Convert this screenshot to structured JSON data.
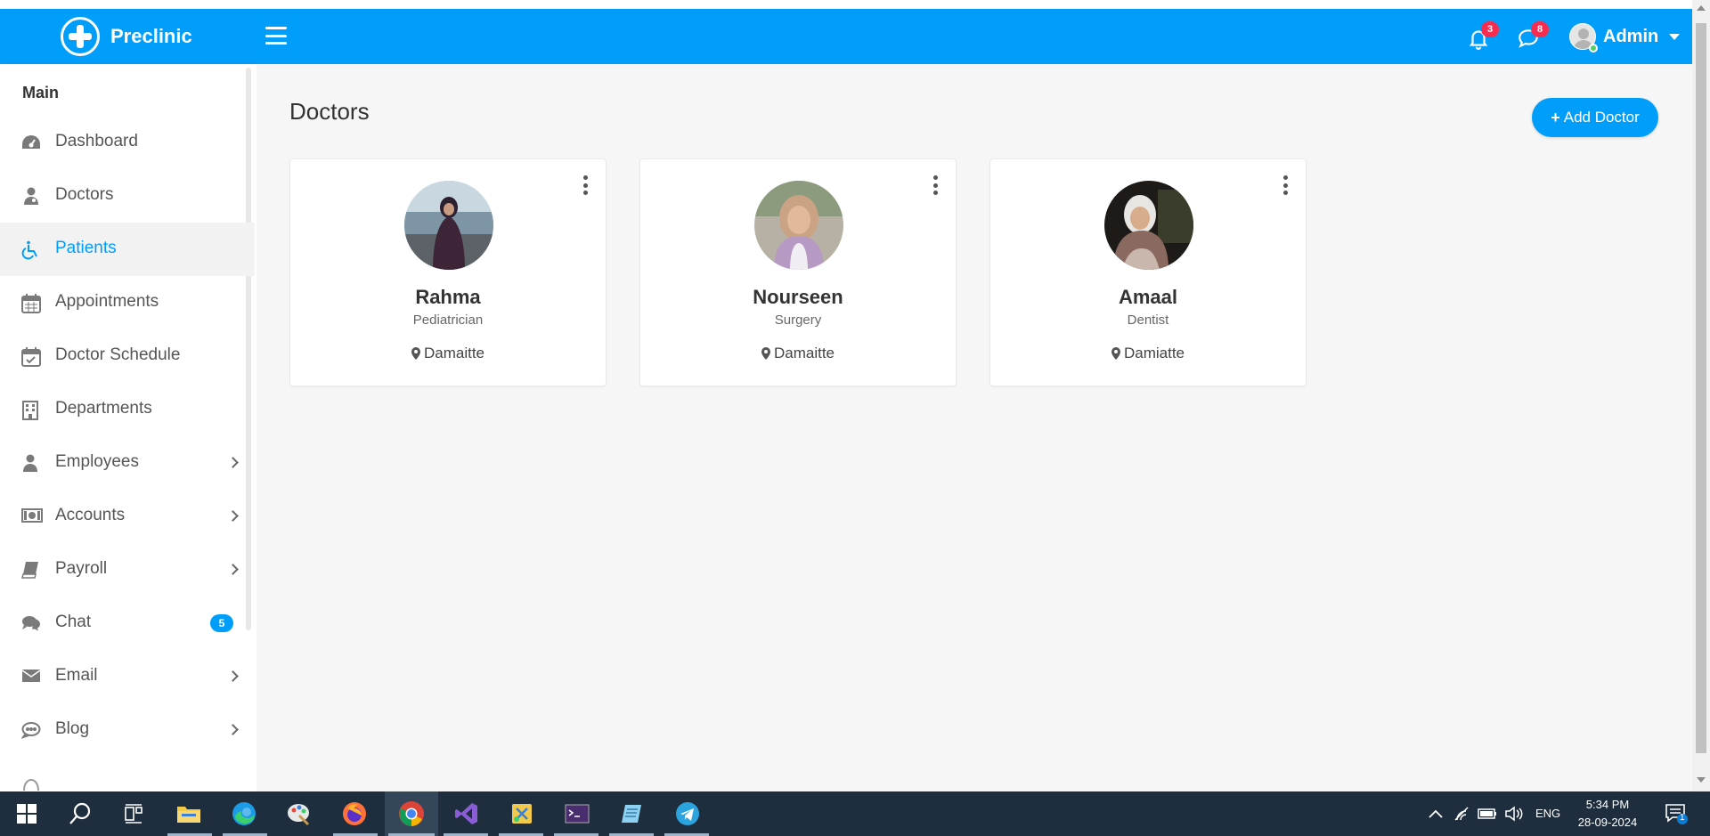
{
  "app": {
    "name": "Preclinic"
  },
  "header": {
    "notifications_count": "3",
    "messages_count": "8",
    "user_name": "Admin"
  },
  "sidebar": {
    "section_title": "Main",
    "items": [
      {
        "label": "Dashboard",
        "icon": "dashboard-icon"
      },
      {
        "label": "Doctors",
        "icon": "doctor-icon"
      },
      {
        "label": "Patients",
        "icon": "wheelchair-icon",
        "active": true
      },
      {
        "label": "Appointments",
        "icon": "calendar-icon"
      },
      {
        "label": "Doctor Schedule",
        "icon": "calendar-check-icon"
      },
      {
        "label": "Departments",
        "icon": "building-icon"
      },
      {
        "label": "Employees",
        "icon": "user-icon",
        "submenu": true
      },
      {
        "label": "Accounts",
        "icon": "money-icon",
        "submenu": true
      },
      {
        "label": "Payroll",
        "icon": "book-icon",
        "submenu": true
      },
      {
        "label": "Chat",
        "icon": "comments-icon",
        "badge": "5"
      },
      {
        "label": "Email",
        "icon": "envelope-icon",
        "submenu": true
      },
      {
        "label": "Blog",
        "icon": "comment-icon",
        "submenu": true
      }
    ]
  },
  "main": {
    "title": "Doctors",
    "add_button_label": "Add Doctor",
    "doctors": [
      {
        "name": "Rahma",
        "specialty": "Pediatrician",
        "location": "Damaitte"
      },
      {
        "name": "Nourseen",
        "specialty": "Surgery",
        "location": "Damaitte"
      },
      {
        "name": "Amaal",
        "specialty": "Dentist",
        "location": "Damiatte"
      }
    ]
  },
  "taskbar": {
    "language": "ENG",
    "time": "5:34 PM",
    "date": "28-09-2024",
    "notification_count": "1"
  },
  "colors": {
    "primary": "#009efb",
    "badge_red": "#f62d51",
    "taskbar": "#1f2e3e"
  }
}
